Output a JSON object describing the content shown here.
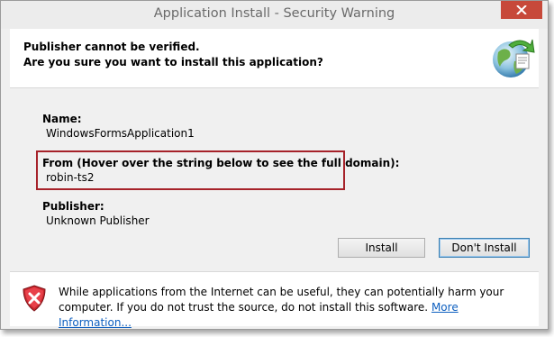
{
  "window": {
    "title": "Application Install - Security Warning"
  },
  "header": {
    "line1": "Publisher cannot be verified.",
    "line2": "Are you sure you want to install this application?",
    "icon": "globe-install-icon"
  },
  "details": {
    "name_label": "Name:",
    "name_value": "WindowsFormsApplication1",
    "from_label": "From (Hover over the string below to see the full domain):",
    "from_value": "robin-ts2",
    "publisher_label": "Publisher:",
    "publisher_value": "Unknown Publisher"
  },
  "buttons": {
    "install": "Install",
    "dont_install": "Don't Install"
  },
  "footer": {
    "warning_icon": "shield-x-icon",
    "text": "While applications from the Internet can be useful, they can potentially harm your computer. If you do not trust the source, do not install this software.",
    "link": "More Information..."
  },
  "colors": {
    "close_button": "#c7493a",
    "highlight_border": "#a6222a",
    "link": "#0c5ebf"
  }
}
